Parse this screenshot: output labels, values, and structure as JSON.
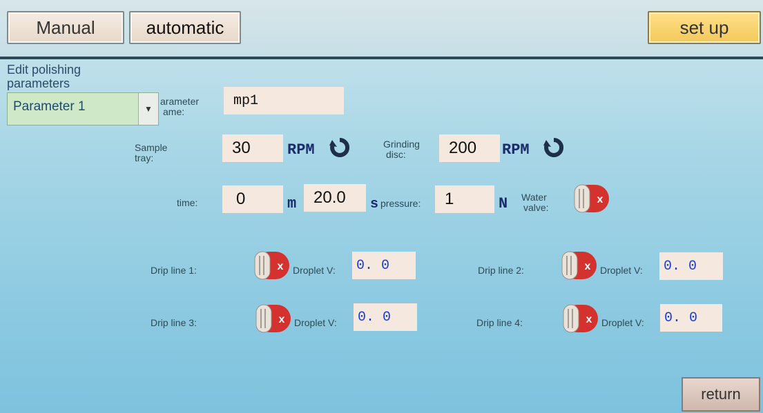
{
  "tabs": {
    "manual": "Manual",
    "automatic": "automatic",
    "setup": "set up"
  },
  "section": {
    "title_line1": "Edit polishing",
    "title_line2": "parameters"
  },
  "parameter_select": {
    "value": "Parameter 1",
    "options_visible": [
      "Parameter 1"
    ]
  },
  "parameter_name": {
    "label_line1": "arameter",
    "label_line2": "ame:",
    "value": "mp1"
  },
  "sample_tray": {
    "label_line1": "Sample",
    "label_line2": "tray:",
    "value": "30",
    "unit": "RPM",
    "icon": "rotate-icon"
  },
  "grinding_disc": {
    "label_line1": "Grinding",
    "label_line2": "disc:",
    "value": "200",
    "unit": "RPM",
    "icon": "rotate-icon"
  },
  "time": {
    "label": "time:",
    "minutes": "0",
    "minutes_unit": "m",
    "seconds": "20.0",
    "seconds_unit": "s"
  },
  "pressure": {
    "label": "pressure:",
    "value": "1",
    "unit": "N"
  },
  "water_valve": {
    "label_line1": "Water",
    "label_line2": "valve:",
    "state": "off"
  },
  "drip_lines": [
    {
      "label": "Drip line 1:",
      "droplet_label": "Droplet V:",
      "value": "0. 0",
      "state": "off"
    },
    {
      "label": "Drip line 2:",
      "droplet_label": "Droplet V:",
      "value": "0. 0",
      "state": "off"
    },
    {
      "label": "Drip line 3:",
      "droplet_label": "Droplet V:",
      "value": "0. 0",
      "state": "off"
    },
    {
      "label": "Drip line 4:",
      "droplet_label": "Droplet V:",
      "value": "0. 0",
      "state": "off"
    }
  ],
  "return_label": "return",
  "colors": {
    "accent_setup": "#f2c85a",
    "toggle_red": "#d3322f",
    "value_blue": "#1a3fd8"
  }
}
